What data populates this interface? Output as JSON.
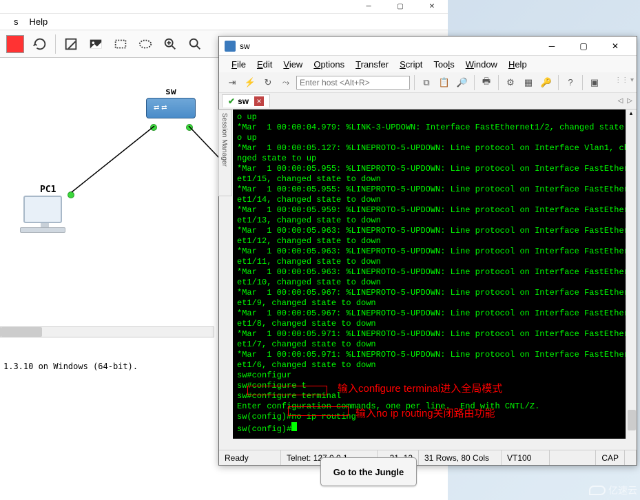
{
  "mainWindow": {
    "menuHelp": "Help"
  },
  "topology": {
    "swLabel": "sw",
    "pcLabel": "PC1"
  },
  "statusLine": "1.3.10 on Windows (64-bit).",
  "crt": {
    "title": "sw",
    "menu": {
      "file": "File",
      "edit": "Edit",
      "view": "View",
      "options": "Options",
      "transfer": "Transfer",
      "script": "Script",
      "tools": "Tools",
      "window": "Window",
      "help": "Help"
    },
    "hostPlaceholder": "Enter host <Alt+R>",
    "tabName": "sw",
    "sessionMgr": "Session Manager",
    "terminal": [
      "o up",
      "*Mar  1 00:00:04.979: %LINK-3-UPDOWN: Interface FastEthernet1/2, changed state t",
      "o up",
      "*Mar  1 00:00:05.127: %LINEPROTO-5-UPDOWN: Line protocol on Interface Vlan1, cha",
      "nged state to up",
      "*Mar  1 00:00:05.955: %LINEPROTO-5-UPDOWN: Line protocol on Interface FastEthern",
      "et1/15, changed state to down",
      "*Mar  1 00:00:05.955: %LINEPROTO-5-UPDOWN: Line protocol on Interface FastEthern",
      "et1/14, changed state to down",
      "*Mar  1 00:00:05.959: %LINEPROTO-5-UPDOWN: Line protocol on Interface FastEthern",
      "et1/13, changed state to down",
      "*Mar  1 00:00:05.963: %LINEPROTO-5-UPDOWN: Line protocol on Interface FastEthern",
      "et1/12, changed state to down",
      "*Mar  1 00:00:05.963: %LINEPROTO-5-UPDOWN: Line protocol on Interface FastEthern",
      "et1/11, changed state to down",
      "*Mar  1 00:00:05.963: %LINEPROTO-5-UPDOWN: Line protocol on Interface FastEthern",
      "et1/10, changed state to down",
      "*Mar  1 00:00:05.967: %LINEPROTO-5-UPDOWN: Line protocol on Interface FastEthern",
      "et1/9, changed state to down",
      "*Mar  1 00:00:05.967: %LINEPROTO-5-UPDOWN: Line protocol on Interface FastEthern",
      "et1/8, changed state to down",
      "*Mar  1 00:00:05.971: %LINEPROTO-5-UPDOWN: Line protocol on Interface FastEthern",
      "et1/7, changed state to down",
      "*Mar  1 00:00:05.971: %LINEPROTO-5-UPDOWN: Line protocol on Interface FastEthern",
      "et1/6, changed state to down",
      "sw#configur",
      "sw#configure t",
      "sw#configure terminal",
      "Enter configuration commands, one per line.  End with CNTL/Z.",
      "sw(config)#no ip routing",
      "sw(config)#"
    ],
    "annot1": "输入configure terminal进入全局模式",
    "annot2": "输入no ip routing关闭路由功能",
    "status": {
      "ready": "Ready",
      "conn": "Telnet: 127.0.0.1",
      "pos": "31,  12",
      "size": "31 Rows, 80 Cols",
      "emul": "VT100",
      "cap": "CAP"
    }
  },
  "jungleBtn": "Go to the Jungle",
  "watermark": "亿速云"
}
